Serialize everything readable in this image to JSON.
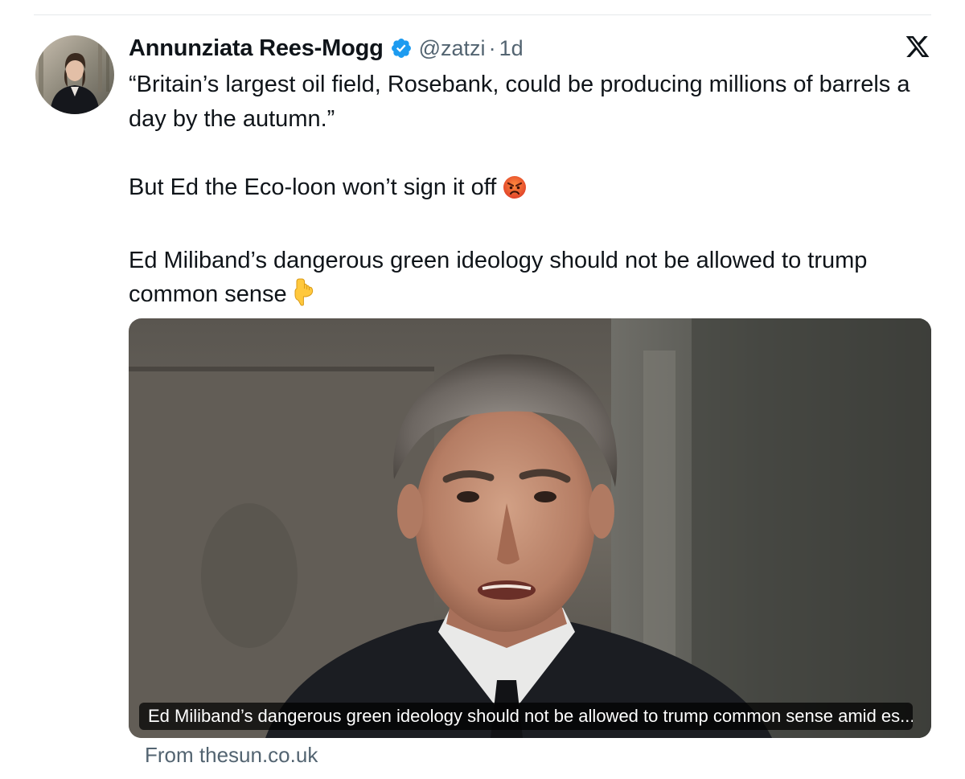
{
  "author": {
    "name": "Annunziata Rees-Mogg",
    "handle": "@zatzi",
    "separator": "·",
    "time": "1d",
    "verified": true,
    "verified_color": "#1d9bf0"
  },
  "tweet": {
    "line1": "“Britain’s largest oil field, Rosebank, could be producing millions of barrels a day by the autumn.”",
    "line2": "But Ed the Eco-loon won’t sign it off",
    "line2_emoji": "angry-face-emoji",
    "line3": "Ed Miliband’s dangerous green ideology should not be allowed to trump common sense",
    "line3_emoji": "backhand-index-pointing-down-emoji"
  },
  "card": {
    "image": "photo-man-in-dark-coat",
    "caption": "Ed Miliband’s dangerous green ideology should not be allowed to trump common sense amid es...",
    "source": "From thesun.co.uk"
  },
  "brand": {
    "logo": "x-logo-icon"
  },
  "colors": {
    "text": "#0f1419",
    "secondary_text": "#536471",
    "verified_badge": "#1d9bf0",
    "background": "#ffffff"
  }
}
